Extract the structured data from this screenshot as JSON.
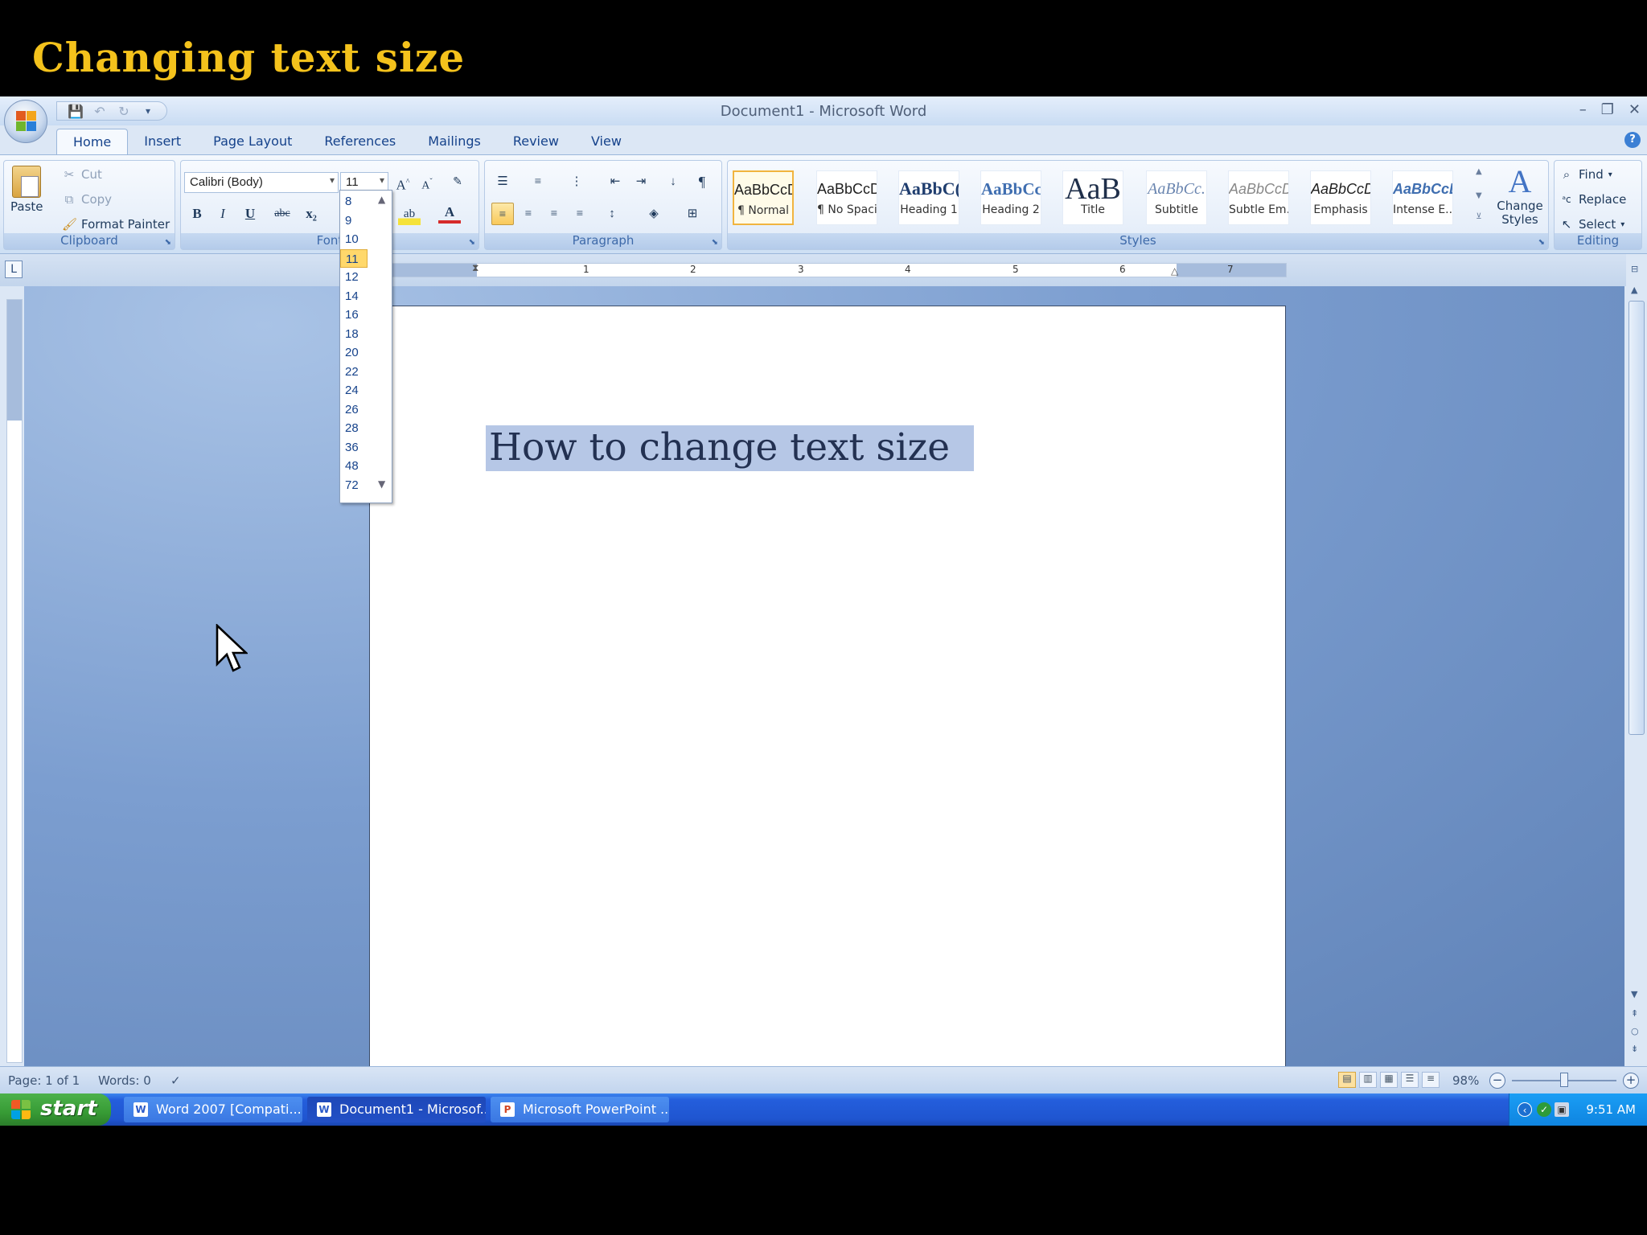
{
  "slide": {
    "title": "Changing text size"
  },
  "window": {
    "title": "Document1 - Microsoft Word",
    "controls": {
      "minimize": "–",
      "restore": "❐",
      "close": "✕"
    }
  },
  "tabs": [
    "Home",
    "Insert",
    "Page Layout",
    "References",
    "Mailings",
    "Review",
    "View"
  ],
  "active_tab": "Home",
  "clipboard": {
    "paste": "Paste",
    "cut": "Cut",
    "copy": "Copy",
    "format_painter": "Format Painter",
    "label": "Clipboard"
  },
  "font": {
    "family": "Calibri (Body)",
    "size": "11",
    "label": "Font",
    "bold": "B",
    "italic": "I",
    "underline": "U",
    "strike": "abc",
    "subscript": "x₂",
    "grow": "A",
    "shrink": "A"
  },
  "paragraph": {
    "label": "Paragraph"
  },
  "styles": {
    "label": "Styles",
    "items": [
      {
        "sample": "AaBbCcDc",
        "name": "¶ Normal"
      },
      {
        "sample": "AaBbCcDc",
        "name": "¶ No Spaci..."
      },
      {
        "sample": "AaBbC(",
        "name": "Heading 1"
      },
      {
        "sample": "AaBbCc",
        "name": "Heading 2"
      },
      {
        "sample": "AaB",
        "name": "Title"
      },
      {
        "sample": "AaBbCc.",
        "name": "Subtitle"
      },
      {
        "sample": "AaBbCcD(",
        "name": "Subtle Em..."
      },
      {
        "sample": "AaBbCcD(",
        "name": "Emphasis"
      },
      {
        "sample": "AaBbCcD(",
        "name": "Intense E..."
      }
    ],
    "change_styles": "Change Styles"
  },
  "editing": {
    "label": "Editing",
    "find": "Find",
    "replace": "Replace",
    "select": "Select"
  },
  "size_dropdown": {
    "options": [
      "8",
      "9",
      "10",
      "11",
      "12",
      "14",
      "16",
      "18",
      "20",
      "22",
      "24",
      "26",
      "28",
      "36",
      "48",
      "72"
    ],
    "selected": "11"
  },
  "ruler": {
    "numbers": [
      "1",
      "2",
      "3",
      "4",
      "5",
      "6",
      "7"
    ]
  },
  "document": {
    "text": "How to change text size"
  },
  "statusbar": {
    "page": "Page: 1 of 1",
    "words": "Words: 0",
    "zoom": "98%"
  },
  "taskbar": {
    "start": "start",
    "tasks": [
      {
        "label": "Word 2007 [Compati...",
        "active": false
      },
      {
        "label": "Document1 - Microsof...",
        "active": true
      },
      {
        "label": "Microsoft PowerPoint ...",
        "active": false
      }
    ],
    "clock": "9:51 AM"
  },
  "colors": {
    "title_gold": "#f4c21c",
    "accent_blue": "#15428b",
    "selection": "#b6c7e6",
    "start_green": "#379b35"
  }
}
